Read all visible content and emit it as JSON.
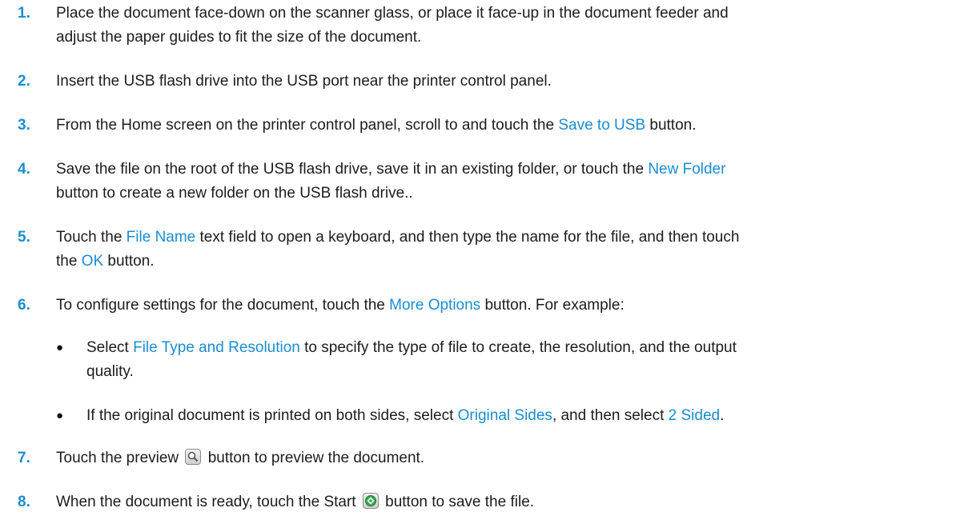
{
  "steps": [
    {
      "num": "1.",
      "line1": "Place the document face-down on the scanner glass, or place it face-up in the document feeder and",
      "line2": "adjust the paper guides to fit the size of the document."
    },
    {
      "num": "2.",
      "text": "Insert the USB flash drive into the USB port near the printer control panel."
    },
    {
      "num": "3.",
      "a": "From the Home screen on the printer control panel, scroll to and touch the ",
      "link": "Save to USB",
      "b": " button."
    },
    {
      "num": "4.",
      "a": "Save the file on the root of the USB flash drive, save it in an existing folder, or touch the ",
      "link": "New Folder",
      "line2": "button to create a new folder on the USB flash drive.."
    },
    {
      "num": "5.",
      "a": "Touch the ",
      "link": "File Name",
      "b": " text field to open a keyboard, and then type the name for the file, and then touch",
      "line2a": "the ",
      "link2": "OK",
      "line2b": " button."
    },
    {
      "num": "6.",
      "a": "To configure settings for the document, touch the ",
      "link": "More Options",
      "b": " button. For example:"
    },
    {
      "num": "7.",
      "a": "Touch the preview ",
      "b": " button to preview the document."
    },
    {
      "num": "8.",
      "a": "When the document is ready, touch the Start ",
      "b": " button to save the file."
    }
  ],
  "bullets": [
    {
      "symbol": "●",
      "a": "Select ",
      "link": "File Type and Resolution",
      "b": " to specify the type of file to create, the resolution, and the output",
      "line2": "quality."
    },
    {
      "symbol": "●",
      "a": "If the original document is printed on both sides, select ",
      "link": "Original Sides",
      "b": ", and then select ",
      "link2": "2 Sided",
      "c": "."
    }
  ],
  "icons": {
    "preview": "magnifier-icon",
    "start": "start-icon",
    "start_color": "#2ea84a",
    "link_color": "#1a8dd1"
  }
}
